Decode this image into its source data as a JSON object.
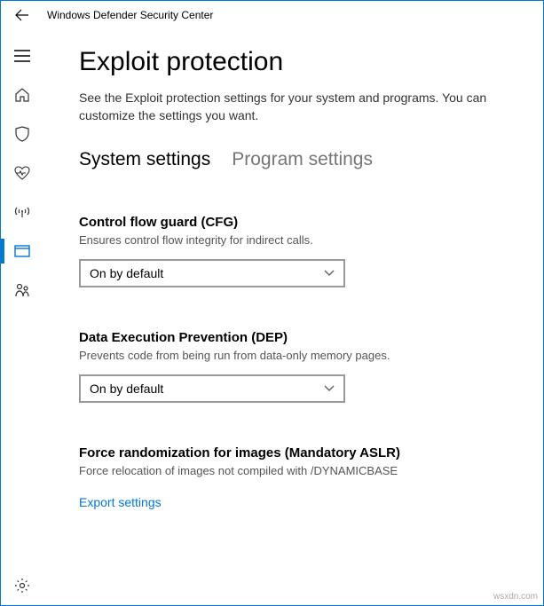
{
  "app": {
    "title": "Windows Defender Security Center"
  },
  "page": {
    "heading": "Exploit protection",
    "description": "See the Exploit protection settings for your system and programs.  You can customize the settings you want."
  },
  "tabs": {
    "system": "System settings",
    "program": "Program settings"
  },
  "settings": {
    "cfg": {
      "title": "Control flow guard (CFG)",
      "desc": "Ensures control flow integrity for indirect calls.",
      "value": "On by default"
    },
    "dep": {
      "title": "Data Execution Prevention (DEP)",
      "desc": "Prevents code from being run from data-only memory pages.",
      "value": "On by default"
    },
    "aslr": {
      "title": "Force randomization for images (Mandatory ASLR)",
      "desc": "Force relocation of images not compiled with /DYNAMICBASE"
    }
  },
  "links": {
    "export": "Export settings"
  },
  "watermark": "wsxdn.com"
}
